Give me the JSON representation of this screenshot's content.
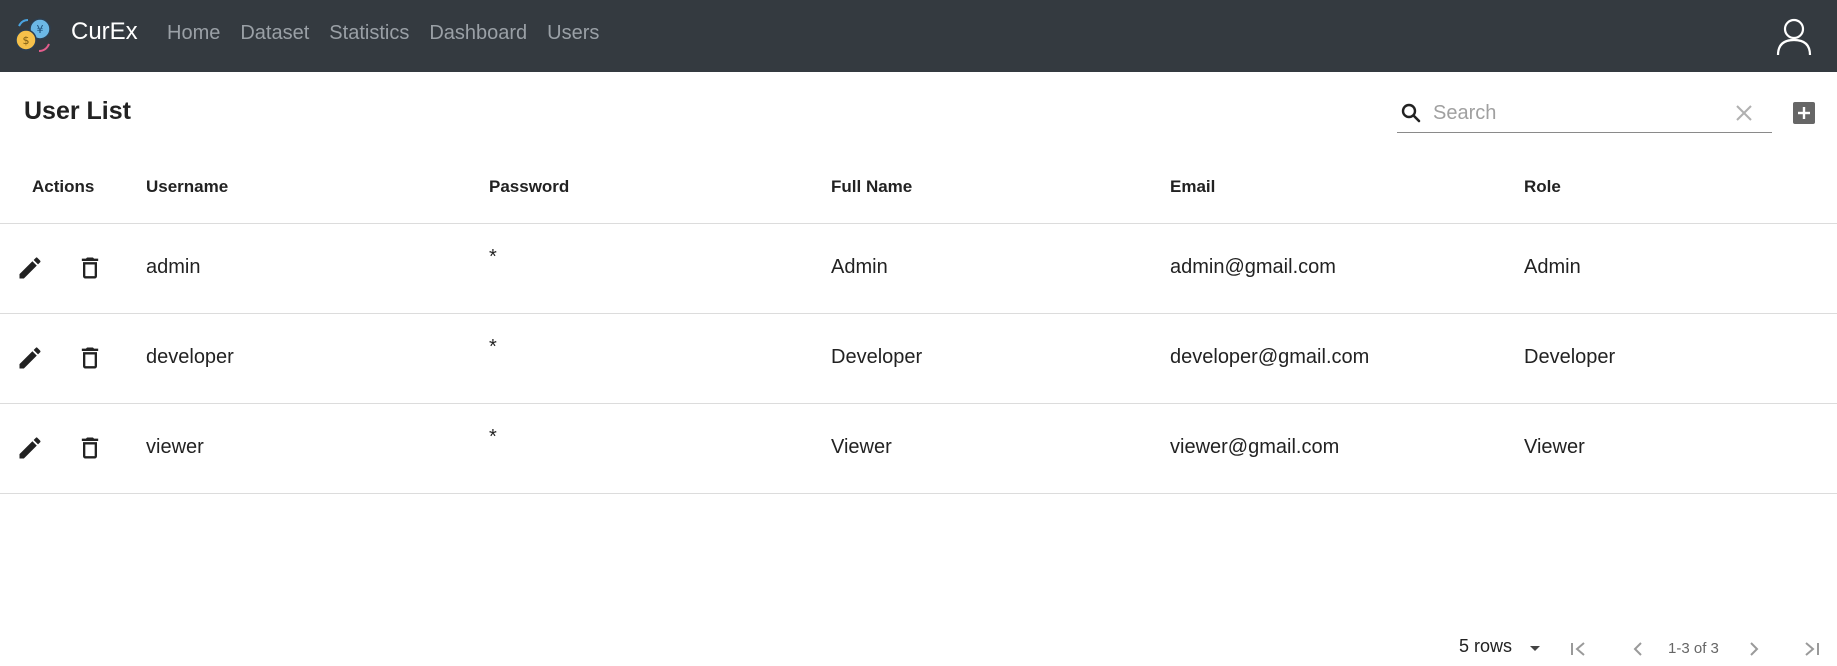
{
  "app": {
    "brand": "CurEx"
  },
  "nav": {
    "links": [
      "Home",
      "Dataset",
      "Statistics",
      "Dashboard",
      "Users"
    ]
  },
  "page": {
    "title": "User List"
  },
  "search": {
    "placeholder": "Search",
    "value": ""
  },
  "table": {
    "headers": {
      "actions": "Actions",
      "username": "Username",
      "password": "Password",
      "full_name": "Full Name",
      "email": "Email",
      "role": "Role"
    },
    "rows": [
      {
        "username": "admin",
        "password": "*",
        "full_name": "Admin",
        "email": "admin@gmail.com",
        "role": "Admin"
      },
      {
        "username": "developer",
        "password": "*",
        "full_name": "Developer",
        "email": "developer@gmail.com",
        "role": "Developer"
      },
      {
        "username": "viewer",
        "password": "*",
        "full_name": "Viewer",
        "email": "viewer@gmail.com",
        "role": "Viewer"
      }
    ]
  },
  "pagination": {
    "rows_label": "5 rows",
    "range": "1-3 of 3"
  },
  "colors": {
    "navbar": "#343a40",
    "nav_link": "#9aa0a6",
    "text": "#222222"
  },
  "icons": [
    "currency-exchange-logo",
    "user-icon",
    "search-icon",
    "clear-icon",
    "add-box-icon",
    "edit-icon",
    "delete-icon",
    "dropdown-arrow-icon",
    "first-page-icon",
    "prev-page-icon",
    "next-page-icon",
    "last-page-icon"
  ]
}
